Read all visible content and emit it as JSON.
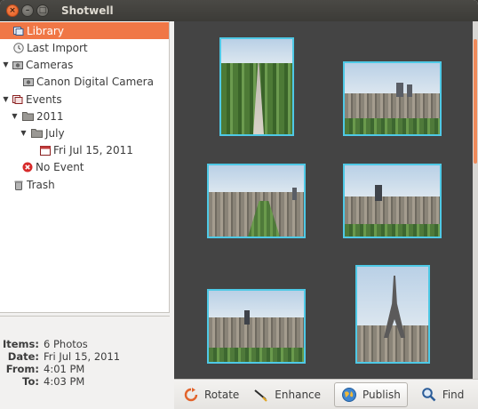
{
  "window": {
    "title": "Shotwell"
  },
  "sidebar": {
    "items": [
      {
        "label": "Library"
      },
      {
        "label": "Last Import"
      },
      {
        "label": "Cameras"
      },
      {
        "label": "Canon Digital Camera"
      },
      {
        "label": "Events"
      },
      {
        "label": "2011"
      },
      {
        "label": "July"
      },
      {
        "label": "Fri Jul 15, 2011"
      },
      {
        "label": "No Event"
      },
      {
        "label": "Trash"
      }
    ]
  },
  "info": {
    "items_key": "Items:",
    "items_val": "6 Photos",
    "date_key": "Date:",
    "date_val": "Fri Jul 15, 2011",
    "from_key": "From:",
    "from_val": "4:01 PM",
    "to_key": "To:",
    "to_val": "4:03 PM"
  },
  "toolbar": {
    "rotate": "Rotate",
    "enhance": "Enhance",
    "publish": "Publish",
    "find": "Find"
  },
  "colors": {
    "selection": "#f07746",
    "thumb_border": "#4ec9e6",
    "photo_bg": "#444444"
  }
}
